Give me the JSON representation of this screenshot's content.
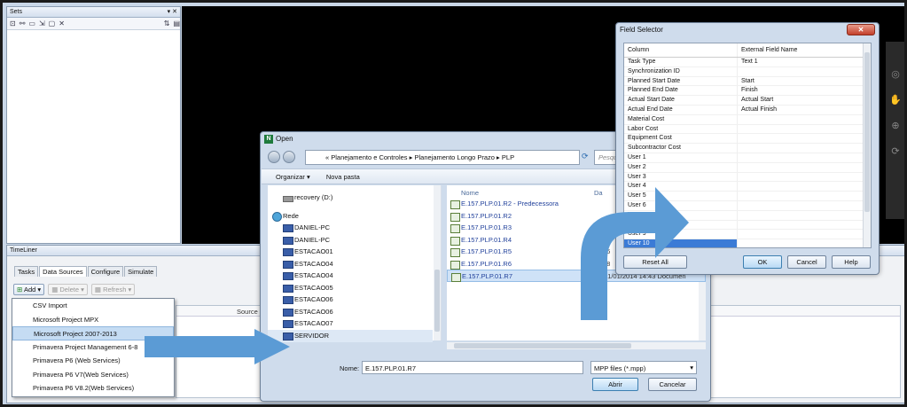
{
  "sets": {
    "title": "Sets",
    "ctrls": "▾ ✕"
  },
  "timeliner": {
    "title": "TimeLiner",
    "tabs": [
      "Tasks",
      "Data Sources",
      "Configure",
      "Simulate"
    ],
    "add_label": "Add",
    "delete_label": "Delete",
    "refresh_label": "Refresh",
    "grid_header": "Source",
    "dropdown": [
      "CSV Import",
      "Microsoft Project MPX",
      "Microsoft Project 2007-2013",
      "Primavera Project Management 6-8",
      "Primavera P6 (Web Services)",
      "Primavera P6 V7(Web Services)",
      "Primavera P6 V8.2(Web Services)"
    ]
  },
  "open_dialog": {
    "title": "Open",
    "path": "« Planejamento e Controles ▸ Planejamento Longo Prazo ▸ PLP",
    "search_placeholder": "Pesqu",
    "organize": "Organizar ▾",
    "new_folder": "Nova pasta",
    "left_items": [
      {
        "label": "recovery (D:)",
        "kind": "drive"
      },
      {
        "label": "Rede",
        "kind": "net"
      },
      {
        "label": "DANIEL-PC",
        "kind": "pc"
      },
      {
        "label": "DANIEL-PC",
        "kind": "pc"
      },
      {
        "label": "ESTACAO01",
        "kind": "pc"
      },
      {
        "label": "ESTACAO04",
        "kind": "pc"
      },
      {
        "label": "ESTACAO04",
        "kind": "pc"
      },
      {
        "label": "ESTACAO05",
        "kind": "pc"
      },
      {
        "label": "ESTACAO06",
        "kind": "pc"
      },
      {
        "label": "ESTACAO06",
        "kind": "pc"
      },
      {
        "label": "ESTACAO07",
        "kind": "pc"
      },
      {
        "label": "SERVIDOR",
        "kind": "pc"
      }
    ],
    "col_name": "Nome",
    "col_date": "Da",
    "files": [
      {
        "name": "E.157.PLP.01.R2 - Predecessora",
        "meta": ""
      },
      {
        "name": "E.157.PLP.01.R2",
        "meta": ""
      },
      {
        "name": "E.157.PLP.01.R3",
        "meta": ""
      },
      {
        "name": "E.157.PLP.01.R4",
        "meta": "01"
      },
      {
        "name": "E.157.PLP.01.R5",
        "meta": "06"
      },
      {
        "name": "E.157.PLP.01.R6",
        "meta": "28"
      },
      {
        "name": "E.157.PLP.01.R7",
        "meta": "31/01/2014 14:43    Documen"
      }
    ],
    "name_label": "Nome:",
    "name_value": "E.157.PLP.01.R7",
    "filetype": "MPP files (*.mpp)",
    "open_btn": "Abrir",
    "cancel_btn": "Cancelar"
  },
  "field_selector": {
    "title": "Field Selector",
    "col1": "Column",
    "col2": "External Field Name",
    "rows": [
      [
        "Task Type",
        "Text 1"
      ],
      [
        "Synchronization ID",
        ""
      ],
      [
        "Planned Start Date",
        "Start"
      ],
      [
        "Planned End Date",
        "Finish"
      ],
      [
        "Actual Start Date",
        "Actual Start"
      ],
      [
        "Actual End Date",
        "Actual Finish"
      ],
      [
        "Material Cost",
        ""
      ],
      [
        "Labor Cost",
        ""
      ],
      [
        "Equipment Cost",
        ""
      ],
      [
        "Subcontractor Cost",
        ""
      ],
      [
        "User 1",
        ""
      ],
      [
        "User 2",
        ""
      ],
      [
        "User 3",
        ""
      ],
      [
        "User 4",
        ""
      ],
      [
        "User 5",
        ""
      ],
      [
        "User 6",
        ""
      ],
      [
        "User 7",
        ""
      ],
      [
        "User 8",
        ""
      ],
      [
        "User 9",
        ""
      ],
      [
        "User 10",
        ""
      ]
    ],
    "reset_btn": "Reset All",
    "ok_btn": "OK",
    "cancel_btn": "Cancel",
    "help_btn": "Help"
  },
  "colors": {
    "arrow": "#5b9bd5"
  }
}
